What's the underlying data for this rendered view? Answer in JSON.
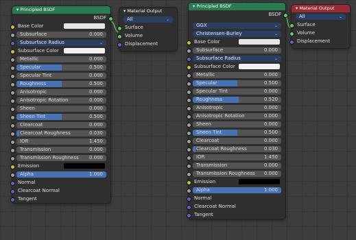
{
  "node1": {
    "title": "▾ Principled BSDF",
    "output_label": "BSDF",
    "rows": [
      {
        "kind": "color",
        "label": "Base Color",
        "color": "#e6e6e6",
        "socket": "yellow"
      },
      {
        "kind": "field",
        "label": "Subsurface",
        "value": "0.000",
        "fill": 0,
        "socket": "grey"
      },
      {
        "kind": "dropdown",
        "label": "Subsurface Radius",
        "socket": "blue"
      },
      {
        "kind": "color",
        "label": "Subsurface Color",
        "color": "#f2f2f2",
        "socket": "yellow"
      },
      {
        "kind": "field",
        "label": "Metallic",
        "value": "0.000",
        "fill": 0,
        "socket": "grey"
      },
      {
        "kind": "field",
        "label": "Specular",
        "value": "0.500",
        "fill": 0.5,
        "socket": "grey"
      },
      {
        "kind": "field",
        "label": "Specular Tint",
        "value": "0.000",
        "fill": 0,
        "socket": "grey"
      },
      {
        "kind": "field",
        "label": "Roughness",
        "value": "0.500",
        "fill": 0.5,
        "socket": "grey"
      },
      {
        "kind": "field",
        "label": "Anisotropic",
        "value": "0.000",
        "fill": 0,
        "socket": "grey"
      },
      {
        "kind": "field",
        "label": "Anisotropic Rotation",
        "value": "0.000",
        "fill": 0,
        "socket": "grey"
      },
      {
        "kind": "field",
        "label": "Sheen",
        "value": "0.000",
        "fill": 0,
        "socket": "grey"
      },
      {
        "kind": "field",
        "label": "Sheen Tint",
        "value": "0.500",
        "fill": 0.5,
        "socket": "grey"
      },
      {
        "kind": "field",
        "label": "Clearcoat",
        "value": "0.000",
        "fill": 0,
        "socket": "grey"
      },
      {
        "kind": "field",
        "label": "Clearcoat Roughness",
        "value": "0.030",
        "fill": 0.03,
        "socket": "grey"
      },
      {
        "kind": "field",
        "label": "IOR",
        "value": "1.450",
        "fill": 0,
        "socket": "grey"
      },
      {
        "kind": "field",
        "label": "Transmission",
        "value": "0.000",
        "fill": 0,
        "socket": "grey"
      },
      {
        "kind": "field",
        "label": "Transmission Roughness",
        "value": "0.000",
        "fill": 0,
        "socket": "grey"
      },
      {
        "kind": "color",
        "label": "Emission",
        "color": "#000000",
        "socket": "yellow"
      },
      {
        "kind": "field",
        "label": "Alpha",
        "value": "1.000",
        "fill": 1,
        "socket": "grey"
      },
      {
        "kind": "plain",
        "label": "Normal",
        "socket": "blue"
      },
      {
        "kind": "plain",
        "label": "Clearcoat Normal",
        "socket": "blue"
      },
      {
        "kind": "plain",
        "label": "Tangent",
        "socket": "blue"
      }
    ]
  },
  "node2": {
    "title": "▾ Material Output",
    "target": "All",
    "inputs": [
      "Surface",
      "Volume",
      "Displacement"
    ]
  },
  "node3": {
    "title": "▾ Principled BSDF",
    "output_label": "BSDF",
    "distribution": "GGX",
    "subsurface_method": "Christensen-Burley",
    "rows": [
      {
        "kind": "color",
        "label": "Base Color",
        "color": "#e6e6e6",
        "socket": "yellow"
      },
      {
        "kind": "field",
        "label": "Subsurface",
        "value": "0.000",
        "fill": 0,
        "socket": "grey"
      },
      {
        "kind": "dropdown",
        "label": "Subsurface Radius",
        "socket": "blue"
      },
      {
        "kind": "color",
        "label": "Subsurface Color",
        "color": "#f2f2f2",
        "socket": "yellow"
      },
      {
        "kind": "field",
        "label": "Metallic",
        "value": "0.000",
        "fill": 0,
        "socket": "grey"
      },
      {
        "kind": "field",
        "label": "Specular",
        "value": "0.500",
        "fill": 0.5,
        "socket": "grey"
      },
      {
        "kind": "field",
        "label": "Specular Tint",
        "value": "0.000",
        "fill": 0,
        "socket": "grey"
      },
      {
        "kind": "field",
        "label": "Roughness",
        "value": "0.520",
        "fill": 0.52,
        "socket": "grey"
      },
      {
        "kind": "field",
        "label": "Anisotropic",
        "value": "0.000",
        "fill": 0,
        "socket": "grey"
      },
      {
        "kind": "field",
        "label": "Anisotropic Rotation",
        "value": "0.000",
        "fill": 0,
        "socket": "grey"
      },
      {
        "kind": "field",
        "label": "Sheen",
        "value": "0.000",
        "fill": 0,
        "socket": "grey"
      },
      {
        "kind": "field",
        "label": "Sheen Tint",
        "value": "0.500",
        "fill": 0.5,
        "socket": "grey"
      },
      {
        "kind": "field",
        "label": "Clearcoat",
        "value": "0.000",
        "fill": 0,
        "socket": "grey"
      },
      {
        "kind": "field",
        "label": "Clearcoat Roughness",
        "value": "0.030",
        "fill": 0.03,
        "socket": "grey"
      },
      {
        "kind": "field",
        "label": "IOR",
        "value": "1.450",
        "fill": 0,
        "socket": "grey"
      },
      {
        "kind": "field",
        "label": "Transmission",
        "value": "0.000",
        "fill": 0,
        "socket": "grey"
      },
      {
        "kind": "field",
        "label": "Transmission Roughness",
        "value": "0.000",
        "fill": 0,
        "socket": "grey"
      },
      {
        "kind": "color",
        "label": "Emission",
        "color": "#000000",
        "socket": "yellow"
      },
      {
        "kind": "field",
        "label": "Alpha",
        "value": "1.000",
        "fill": 1,
        "socket": "grey"
      },
      {
        "kind": "plain",
        "label": "Normal",
        "socket": "blue"
      },
      {
        "kind": "plain",
        "label": "Clearcoat Normal",
        "socket": "blue"
      },
      {
        "kind": "plain",
        "label": "Tangent",
        "socket": "blue"
      }
    ]
  },
  "node4": {
    "title": "▾ Material Output",
    "target": "All",
    "inputs": [
      "Surface",
      "Volume",
      "Displacement"
    ]
  },
  "colors": {
    "background": "#3d3d3d",
    "node_body": "#2f2f2f",
    "header_shader": "#2a7a52",
    "header_output": "#9a2b35",
    "field": "#545454",
    "field_fill": "#4772b3",
    "dropdown": "#2b3f63",
    "socket_color": "#c7c729",
    "socket_float": "#a1a1a1",
    "socket_vector": "#6363c7",
    "socket_shader": "#62c96a"
  }
}
